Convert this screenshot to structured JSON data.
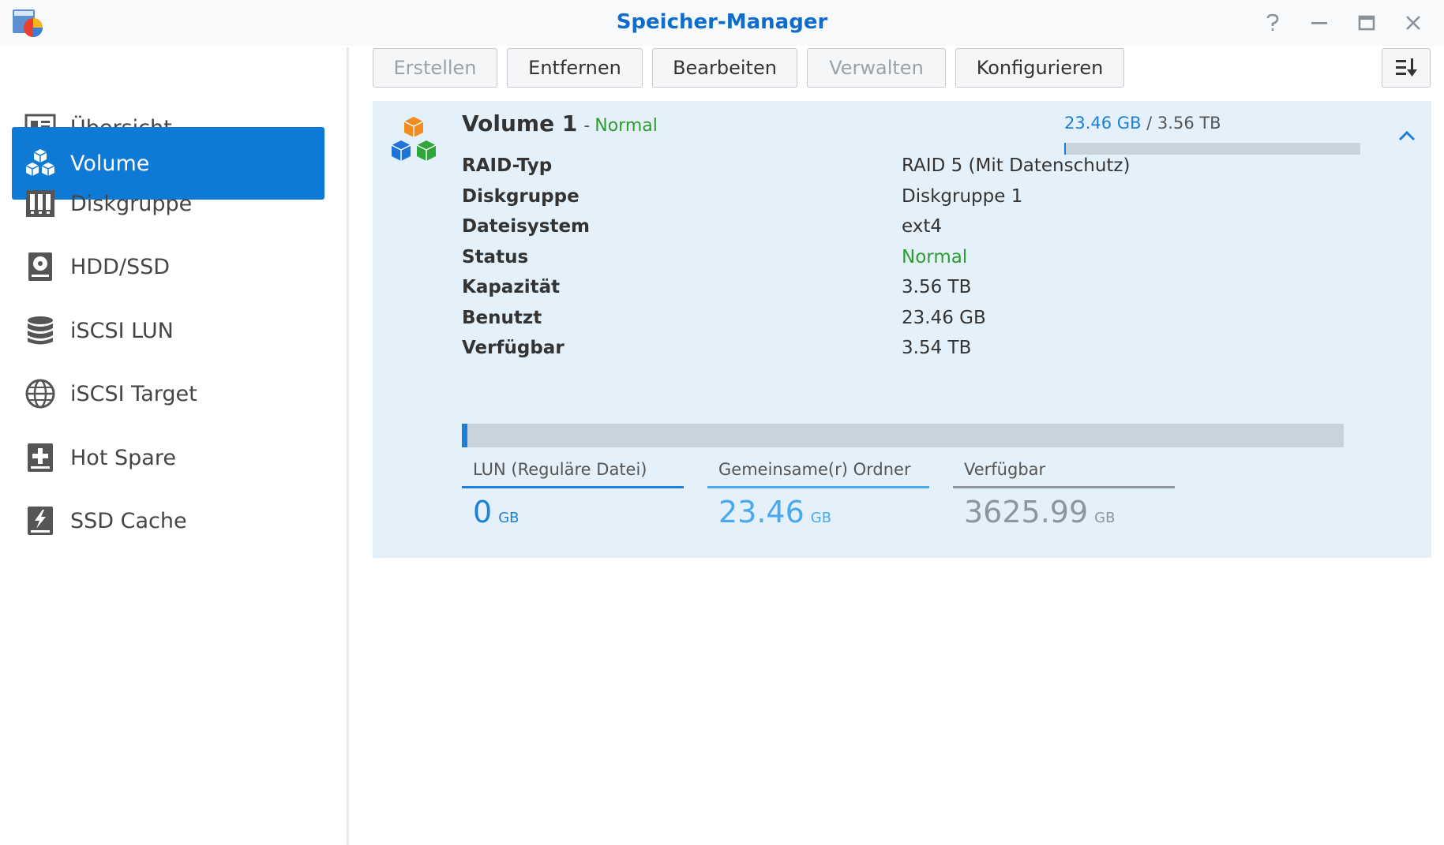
{
  "window": {
    "title": "Speicher-Manager",
    "icons": [
      "app-icon",
      "help-icon",
      "minimize-icon",
      "maximize-icon",
      "close-icon"
    ]
  },
  "sidebar": {
    "items": [
      {
        "label": "Übersicht",
        "icon": "overview-icon",
        "active": false
      },
      {
        "label": "Volume",
        "icon": "volume-cubes-icon",
        "active": true
      },
      {
        "label": "Diskgruppe",
        "icon": "diskgroup-icon",
        "active": false
      },
      {
        "label": "HDD/SSD",
        "icon": "hdd-icon",
        "active": false
      },
      {
        "label": "iSCSI LUN",
        "icon": "database-icon",
        "active": false
      },
      {
        "label": "iSCSI Target",
        "icon": "globe-icon",
        "active": false
      },
      {
        "label": "Hot Spare",
        "icon": "hot-spare-plus-icon",
        "active": false
      },
      {
        "label": "SSD Cache",
        "icon": "ssd-cache-bolt-icon",
        "active": false
      }
    ]
  },
  "toolbar": {
    "create_label": "Erstellen",
    "remove_label": "Entfernen",
    "edit_label": "Bearbeiten",
    "manage_label": "Verwalten",
    "configure_label": "Konfigurieren",
    "disabled": [
      "create",
      "manage"
    ]
  },
  "volume": {
    "name": "Volume 1",
    "separator": "-",
    "status": "Normal",
    "usage_used": "23.46 GB",
    "usage_sep": " / ",
    "usage_total": "3.56 TB",
    "usage_fraction": 0.0064,
    "properties": [
      {
        "label": "RAID-Typ",
        "value": "RAID 5 (Mit Datenschutz)"
      },
      {
        "label": "Diskgruppe",
        "value": "Diskgruppe 1"
      },
      {
        "label": "Dateisystem",
        "value": "ext4"
      },
      {
        "label": "Status",
        "value": "Normal"
      },
      {
        "label": "Kapazität",
        "value": "3.56 TB"
      },
      {
        "label": "Benutzt",
        "value": "23.46 GB"
      },
      {
        "label": "Verfügbar",
        "value": "3.54 TB"
      }
    ],
    "capacity_fraction": 0.0064,
    "legend": [
      {
        "label": "LUN (Reguläre Datei)",
        "value": "0",
        "unit": "GB",
        "color": "#1d7fd6"
      },
      {
        "label": "Gemeinsame(r) Ordner",
        "value": "23.46",
        "unit": "GB",
        "color": "#4aa8ee"
      },
      {
        "label": "Verfügbar",
        "value": "3625.99",
        "unit": "GB",
        "color": "#8e959c"
      }
    ]
  },
  "colors": {
    "accent": "#0e7ad6",
    "title": "#0e6dcc",
    "ok_green": "#2e9c2e",
    "panel_bg": "#e4f1fb"
  }
}
